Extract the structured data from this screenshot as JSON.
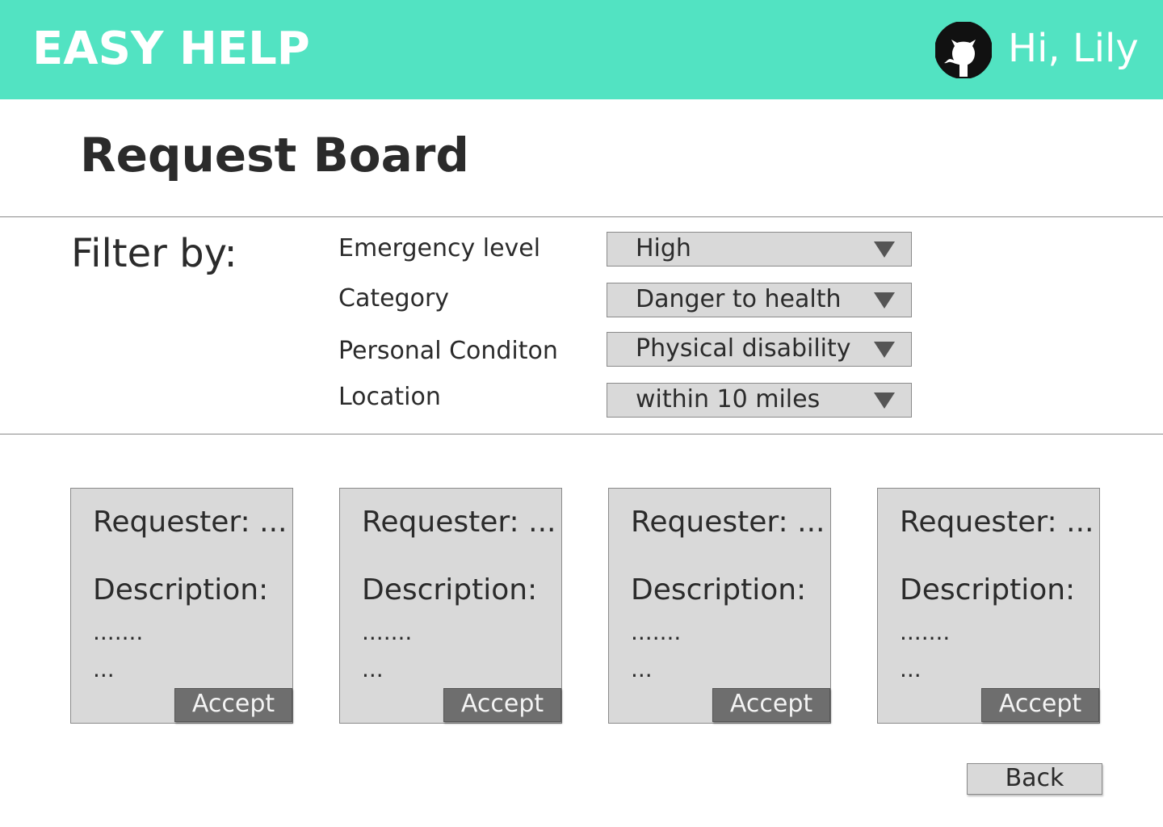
{
  "header": {
    "brand": "EASY HELP",
    "greeting": "Hi, Lily",
    "avatar_icon": "github-octocat-icon",
    "background_color": "#52e3c2"
  },
  "main": {
    "title": "Request Board"
  },
  "filter": {
    "heading": "Filter by:",
    "fields": [
      {
        "label": "Emergency level",
        "value": "High"
      },
      {
        "label": "Category",
        "value": "Danger to health"
      },
      {
        "label": "Personal Conditon",
        "value": "Physical disability"
      },
      {
        "label": "Location",
        "value": "within 10 miles"
      }
    ]
  },
  "cards": [
    {
      "requester": "Requester: ...",
      "description": "Description:",
      "line1": ".......",
      "line2": "...",
      "accept_label": "Accept"
    },
    {
      "requester": "Requester: ...",
      "description": "Description:",
      "line1": ".......",
      "line2": "...",
      "accept_label": "Accept"
    },
    {
      "requester": "Requester: ...",
      "description": "Description:",
      "line1": ".......",
      "line2": "...",
      "accept_label": "Accept"
    },
    {
      "requester": "Requester: ...",
      "description": "Description:",
      "line1": ".......",
      "line2": "...",
      "accept_label": "Accept"
    }
  ],
  "footer": {
    "back_label": "Back"
  }
}
